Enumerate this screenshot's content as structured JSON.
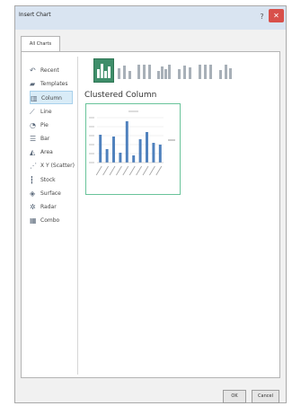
{
  "window": {
    "title": "Insert Chart",
    "help": "?",
    "close": "✕"
  },
  "tabs": [
    {
      "label": "All Charts"
    }
  ],
  "categories": [
    {
      "label": "Recent",
      "icon": "recent-icon",
      "glyph": "↶",
      "selected": false
    },
    {
      "label": "Templates",
      "icon": "templates-icon",
      "glyph": "▰",
      "selected": false
    },
    {
      "label": "Column",
      "icon": "column-chart-icon",
      "glyph": "▥",
      "selected": true
    },
    {
      "label": "Line",
      "icon": "line-chart-icon",
      "glyph": "⟋",
      "selected": false
    },
    {
      "label": "Pie",
      "icon": "pie-chart-icon",
      "glyph": "◔",
      "selected": false
    },
    {
      "label": "Bar",
      "icon": "bar-chart-icon",
      "glyph": "☰",
      "selected": false
    },
    {
      "label": "Area",
      "icon": "area-chart-icon",
      "glyph": "◭",
      "selected": false
    },
    {
      "label": "X Y (Scatter)",
      "icon": "scatter-chart-icon",
      "glyph": "⋰",
      "selected": false
    },
    {
      "label": "Stock",
      "icon": "stock-chart-icon",
      "glyph": "┇",
      "selected": false
    },
    {
      "label": "Surface",
      "icon": "surface-chart-icon",
      "glyph": "◈",
      "selected": false
    },
    {
      "label": "Radar",
      "icon": "radar-chart-icon",
      "glyph": "✲",
      "selected": false
    },
    {
      "label": "Combo",
      "icon": "combo-chart-icon",
      "glyph": "▦",
      "selected": false
    }
  ],
  "subtypes": [
    {
      "icon": "clustered-column-icon",
      "selected": true
    },
    {
      "icon": "stacked-column-icon",
      "selected": false
    },
    {
      "icon": "100-stacked-column-icon",
      "selected": false
    },
    {
      "icon": "3d-clustered-column-icon",
      "selected": false
    },
    {
      "icon": "3d-stacked-column-icon",
      "selected": false
    },
    {
      "icon": "3d-100-stacked-column-icon",
      "selected": false
    },
    {
      "icon": "3d-column-icon",
      "selected": false
    }
  ],
  "selected_subtype_name": "Clustered Column",
  "preview": {
    "values": [
      62,
      30,
      58,
      22,
      92,
      16,
      52,
      68,
      44,
      40
    ],
    "bar_color": "#4f81bd"
  },
  "buttons": {
    "ok": "OK",
    "cancel": "Cancel"
  },
  "colors": {
    "accent": "#3f8e6a",
    "selection": "#d9ecf7",
    "close": "#d8504a"
  }
}
